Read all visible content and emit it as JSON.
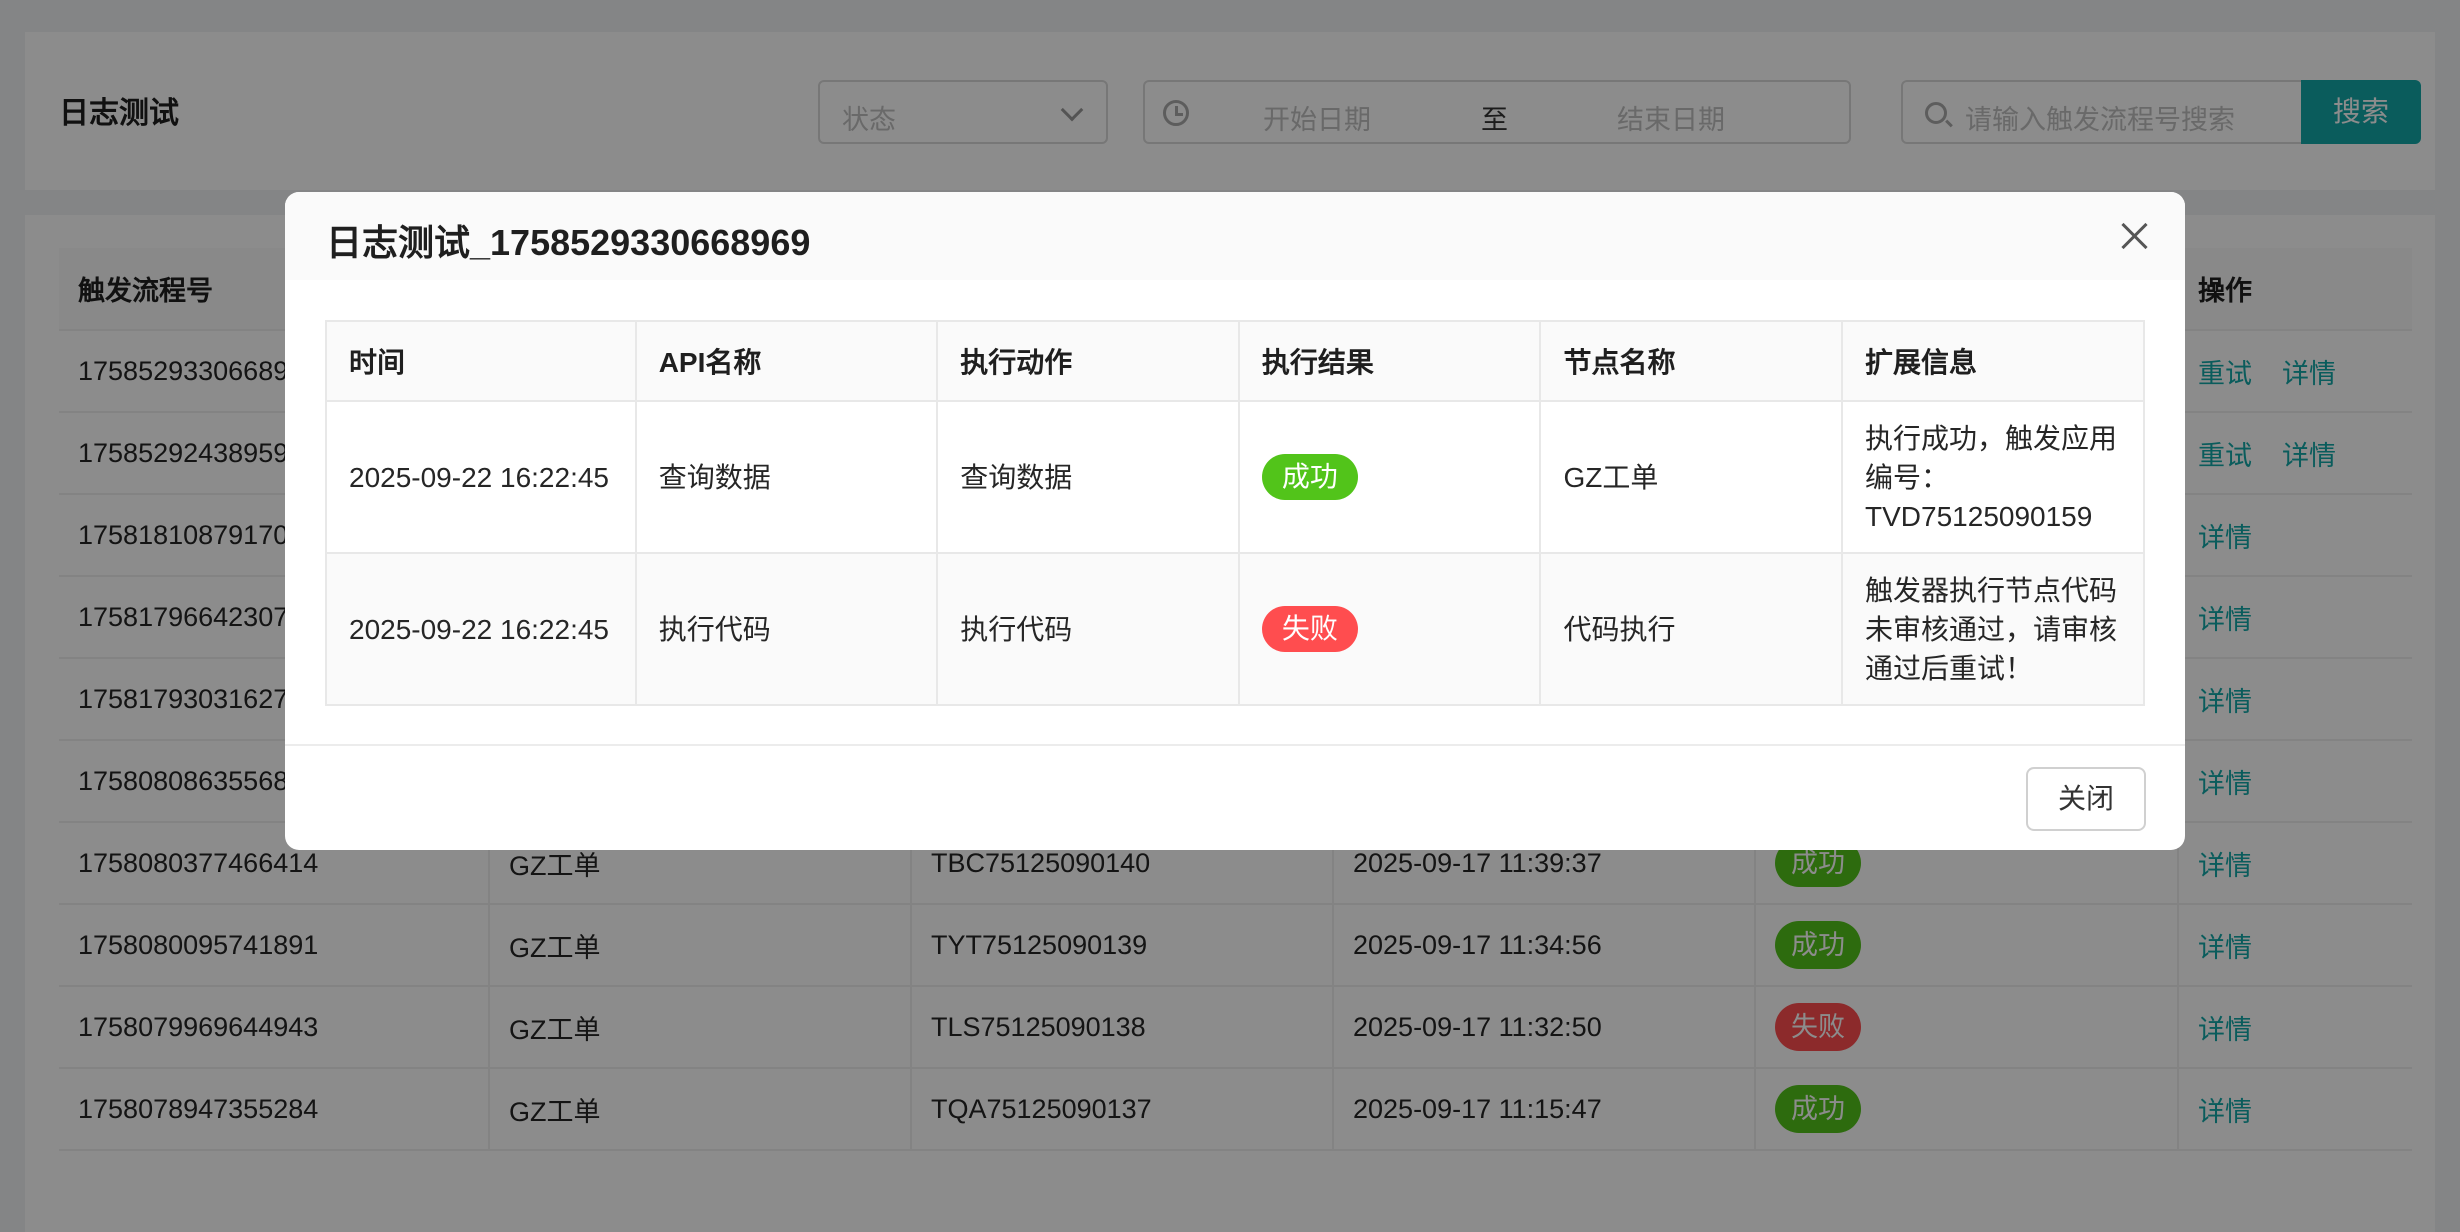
{
  "page": {
    "title": "日志测试",
    "filters": {
      "status_placeholder": "状态",
      "start_date_placeholder": "开始日期",
      "date_separator": "至",
      "end_date_placeholder": "结束日期",
      "search_placeholder": "请输入触发流程号搜索",
      "search_button": "搜索"
    },
    "table": {
      "headers": [
        "触发流程号",
        "",
        "",
        "",
        "",
        "操作"
      ],
      "rows": [
        {
          "id": "17585293306689",
          "node": "",
          "app_no": "",
          "time": "",
          "status": "",
          "actions": [
            "重试",
            "详情"
          ]
        },
        {
          "id": "17585292438959",
          "node": "",
          "app_no": "",
          "time": "",
          "status": "",
          "actions": [
            "重试",
            "详情"
          ]
        },
        {
          "id": "17581810879170",
          "node": "",
          "app_no": "",
          "time": "",
          "status": "",
          "actions": [
            "详情"
          ]
        },
        {
          "id": "17581796642307",
          "node": "",
          "app_no": "",
          "time": "",
          "status": "",
          "actions": [
            "详情"
          ]
        },
        {
          "id": "17581793031627",
          "node": "",
          "app_no": "",
          "time": "",
          "status": "",
          "actions": [
            "详情"
          ]
        },
        {
          "id": "17580808635568",
          "node": "",
          "app_no": "",
          "time": "",
          "status": "",
          "actions": [
            "详情"
          ]
        },
        {
          "id": "1758080377466414",
          "node": "GZ工单",
          "app_no": "TBC75125090140",
          "time": "2025-09-17 11:39:37",
          "status": "成功",
          "actions": [
            "详情"
          ]
        },
        {
          "id": "1758080095741891",
          "node": "GZ工单",
          "app_no": "TYT75125090139",
          "time": "2025-09-17 11:34:56",
          "status": "成功",
          "actions": [
            "详情"
          ]
        },
        {
          "id": "1758079969644943",
          "node": "GZ工单",
          "app_no": "TLS75125090138",
          "time": "2025-09-17 11:32:50",
          "status": "失败",
          "actions": [
            "详情"
          ]
        },
        {
          "id": "1758078947355284",
          "node": "GZ工单",
          "app_no": "TQA75125090137",
          "time": "2025-09-17 11:15:47",
          "status": "成功",
          "actions": [
            "详情"
          ]
        }
      ]
    }
  },
  "modal": {
    "title": "日志测试_1758529330668969",
    "headers": [
      "时间",
      "API名称",
      "执行动作",
      "执行结果",
      "节点名称",
      "扩展信息"
    ],
    "rows": [
      {
        "time": "2025-09-22 16:22:45",
        "api": "查询数据",
        "action": "查询数据",
        "result": "成功",
        "node": "GZ工单",
        "ext": "执行成功，触发应用编号：TVD75125090159"
      },
      {
        "time": "2025-09-22 16:22:45",
        "api": "执行代码",
        "action": "执行代码",
        "result": "失败",
        "node": "代码执行",
        "ext": "触发器执行节点代码未审核通过，请审核通过后重试！"
      }
    ],
    "close_button": "关闭"
  },
  "colors": {
    "accent": "#13a8a8",
    "success": "#52c41a",
    "fail": "#ff4d4f"
  }
}
